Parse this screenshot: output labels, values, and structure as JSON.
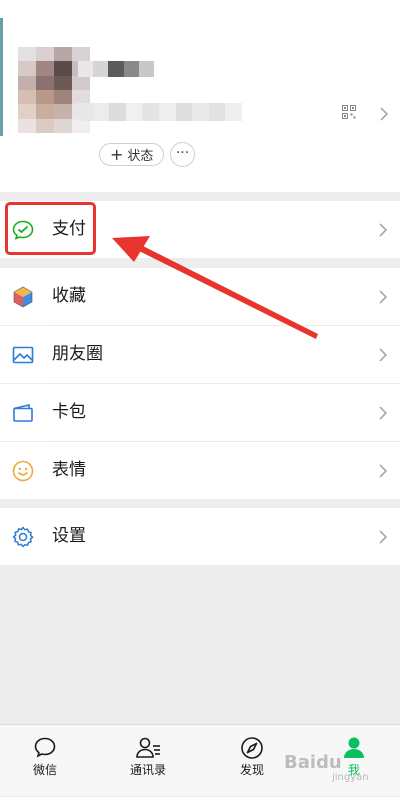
{
  "profile": {
    "status_label": "状态",
    "accent_color": "#6aa1a8"
  },
  "menu": {
    "pay": "支付",
    "favorites": "收藏",
    "moments": "朋友圈",
    "cards": "卡包",
    "stickers": "表情",
    "settings": "设置"
  },
  "tabbar": {
    "chats": "微信",
    "contacts": "通讯录",
    "discover": "发现",
    "me": "我",
    "active_color": "#07c160"
  },
  "annotation": {
    "highlight_color": "#e8342c"
  },
  "watermark": {
    "brand": "Baidu",
    "sub": "jingyan"
  }
}
